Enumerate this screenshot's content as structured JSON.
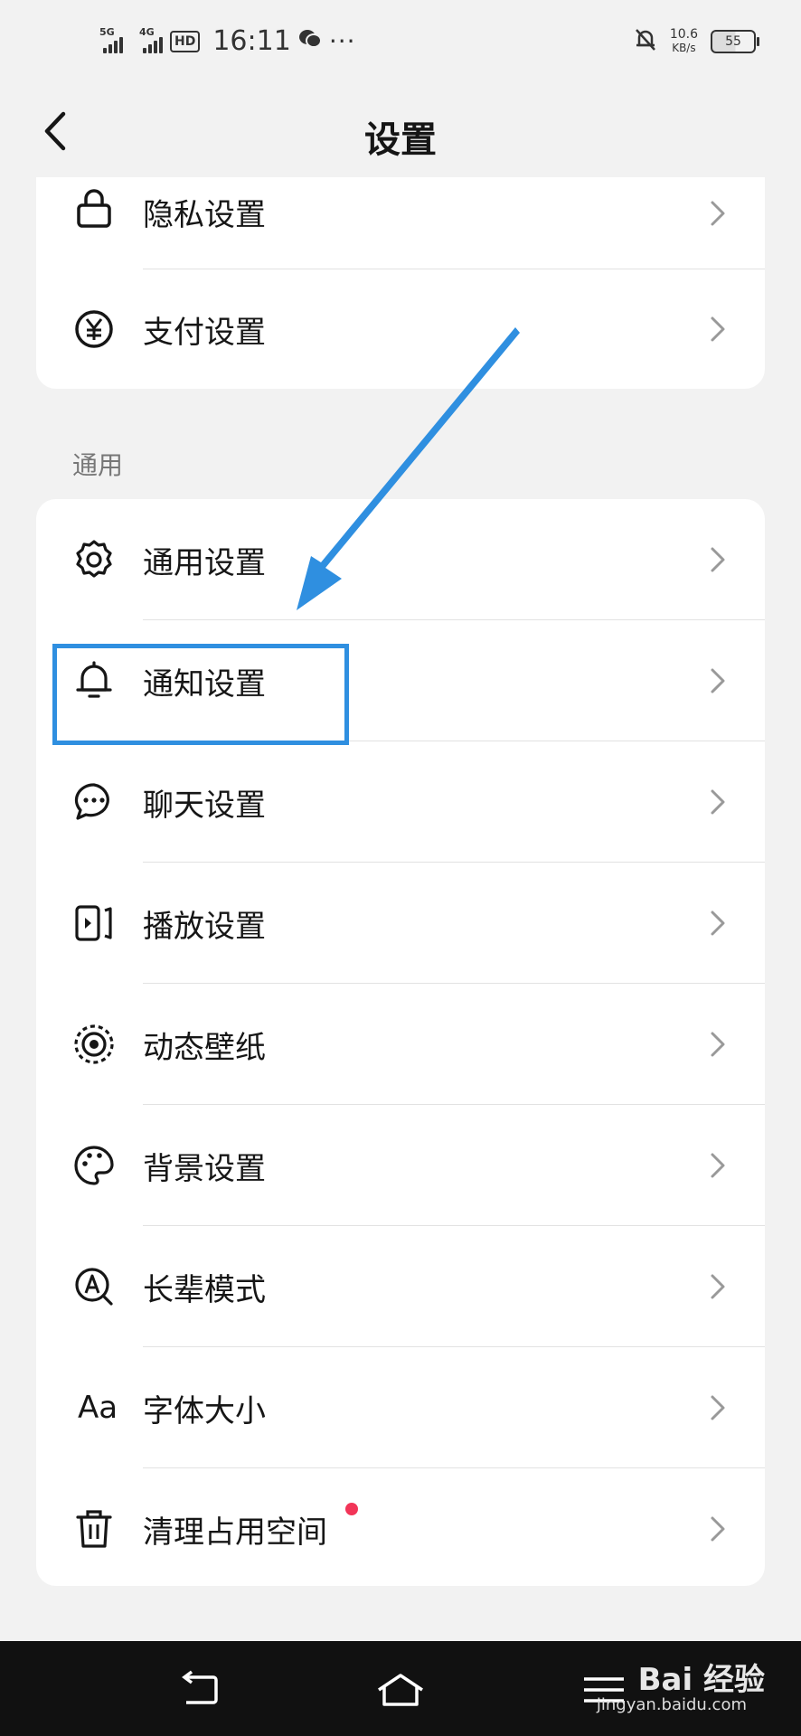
{
  "status_bar": {
    "net1": "5G",
    "net2": "4G",
    "hd": "HD",
    "time": "16:11",
    "more": "···",
    "speed_value": "10.6",
    "speed_unit": "KB/s",
    "battery": "55"
  },
  "header": {
    "title": "设置",
    "back_icon": "chevron-left-icon"
  },
  "top_group": {
    "items": [
      {
        "label": "隐私设置",
        "icon": "lock-icon"
      },
      {
        "label": "支付设置",
        "icon": "yen-icon"
      }
    ]
  },
  "general_section": {
    "title": "通用",
    "items": [
      {
        "label": "通用设置",
        "icon": "gear-icon"
      },
      {
        "label": "通知设置",
        "icon": "bell-icon"
      },
      {
        "label": "聊天设置",
        "icon": "chat-bubble-icon"
      },
      {
        "label": "播放设置",
        "icon": "play-screen-icon"
      },
      {
        "label": "动态壁纸",
        "icon": "live-wallpaper-icon"
      },
      {
        "label": "背景设置",
        "icon": "palette-icon"
      },
      {
        "label": "长辈模式",
        "icon": "elder-mode-icon"
      },
      {
        "label": "字体大小",
        "icon": "font-size-icon",
        "icon_text": "Aa"
      },
      {
        "label": "清理占用空间",
        "icon": "trash-icon"
      }
    ]
  },
  "watermark": {
    "brand": "Bai 经验",
    "url": "jingyan.baidu.com"
  },
  "colors": {
    "background": "#f2f2f2",
    "card": "#ffffff",
    "annotation": "#2f8fe0",
    "badge": "#f23558"
  }
}
